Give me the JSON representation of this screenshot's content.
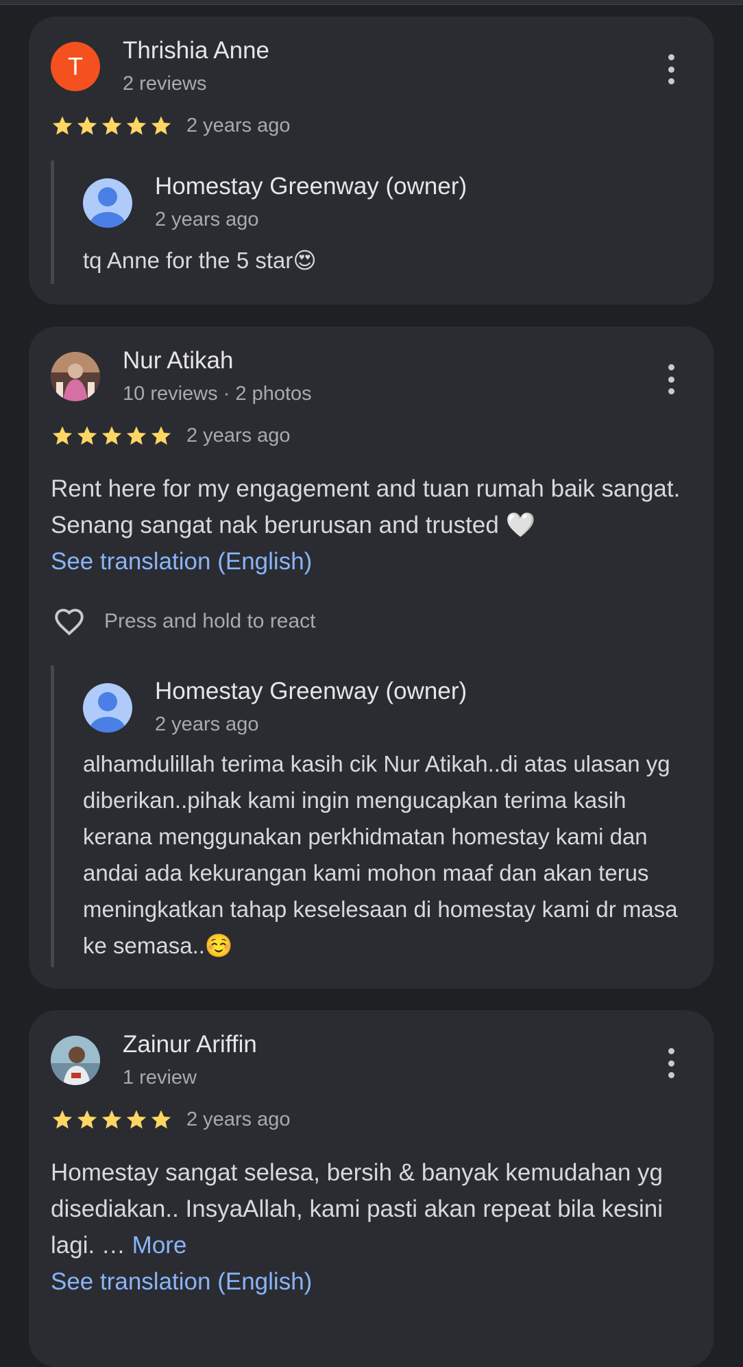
{
  "reviews": [
    {
      "author_initial": "T",
      "author_name": "Thrishia Anne",
      "author_meta": "2 reviews",
      "time": "2 years ago",
      "rating": 5,
      "owner_reply": {
        "name": "Homestay Greenway (owner)",
        "time": "2 years ago",
        "text": "tq Anne for the 5 star😍"
      }
    },
    {
      "author_name": "Nur Atikah",
      "author_meta": "10 reviews · 2 photos",
      "time": "2 years ago",
      "rating": 5,
      "text": "Rent here for my engagement and tuan rumah baik sangat. Senang sangat nak berurusan and trusted 🤍",
      "see_translation": "See translation (English)",
      "react_label": "Press and hold to react",
      "owner_reply": {
        "name": "Homestay Greenway (owner)",
        "time": "2 years ago",
        "text": "alhamdulillah terima kasih cik Nur Atikah..di atas ulasan yg diberikan..pihak kami ingin mengucapkan terima kasih kerana menggunakan perkhidmatan homestay kami dan andai ada kekurangan kami mohon maaf dan akan terus meningkatkan tahap keselesaan di homestay kami dr masa ke semasa..☺️"
      }
    },
    {
      "author_name": "Zainur Ariffin",
      "author_meta": "1 review",
      "time": "2 years ago",
      "rating": 5,
      "text": "Homestay sangat selesa, bersih & banyak kemudahan yg disediakan.. InsyaAllah, kami pasti akan repeat bila kesini lagi. …",
      "more_label": "More",
      "see_translation": "See translation (English)"
    }
  ],
  "colors": {
    "background": "#1f2024",
    "card": "#2a2c32",
    "star": "#fdd663",
    "link": "#8ab4f8",
    "avatar_orange": "#f4511e",
    "owner_avatar": "#aecbfa"
  },
  "icons": [
    "more-vert-icon",
    "star-icon",
    "heart-outline-icon",
    "person-avatar-icon"
  ]
}
